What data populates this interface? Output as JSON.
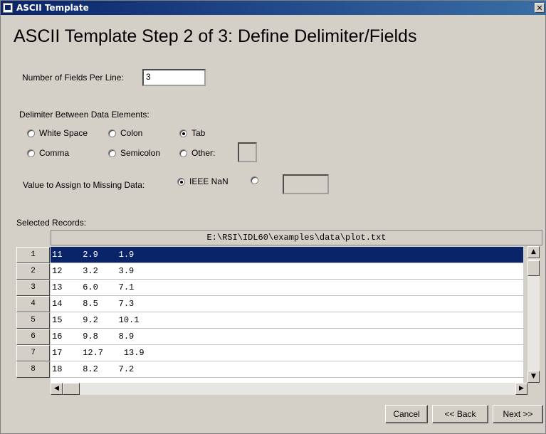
{
  "window": {
    "title": "ASCII Template",
    "close_glyph": "✕"
  },
  "heading": "ASCII Template Step 2 of 3: Define Delimiter/Fields",
  "fields_per_line": {
    "label": "Number of Fields Per Line:",
    "value": "3"
  },
  "delimiter": {
    "label": "Delimiter Between Data Elements:",
    "options": [
      {
        "label": "White Space",
        "selected": false
      },
      {
        "label": "Colon",
        "selected": false
      },
      {
        "label": "Tab",
        "selected": true
      },
      {
        "label": "Comma",
        "selected": false
      },
      {
        "label": "Semicolon",
        "selected": false
      },
      {
        "label": "Other:",
        "selected": false
      }
    ],
    "other_value": ""
  },
  "missing_data": {
    "label": "Value to Assign to Missing Data:",
    "options": [
      {
        "label": "IEEE NaN",
        "selected": true
      },
      {
        "label": "",
        "selected": false
      }
    ],
    "custom_value": ""
  },
  "records": {
    "label": "Selected Records:",
    "file_path": "E:\\RSI\\IDL60\\examples\\data\\plot.txt",
    "rows": [
      {
        "num": "1",
        "text": "11    2.9    1.9"
      },
      {
        "num": "2",
        "text": "12    3.2    3.9"
      },
      {
        "num": "3",
        "text": "13    6.0    7.1"
      },
      {
        "num": "4",
        "text": "14    8.5    7.3"
      },
      {
        "num": "5",
        "text": "15    9.2    10.1"
      },
      {
        "num": "6",
        "text": "16    9.8    8.9"
      },
      {
        "num": "7",
        "text": "17    12.7    13.9"
      },
      {
        "num": "8",
        "text": "18    8.2    7.2"
      }
    ]
  },
  "buttons": {
    "cancel": "Cancel",
    "back": "<< Back",
    "next": "Next >>"
  }
}
